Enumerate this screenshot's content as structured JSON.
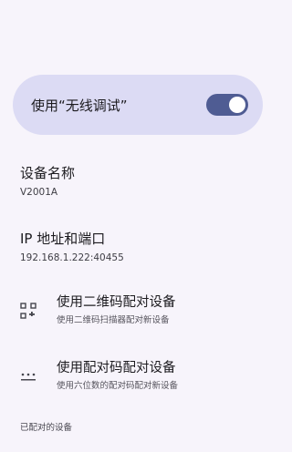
{
  "wireless_debugging": {
    "label": "使用“无线调试”",
    "enabled": true
  },
  "device_name": {
    "title": "设备名称",
    "value": "V2001A"
  },
  "ip_port": {
    "title": "IP 地址和端口",
    "value": "192.168.1.222:40455"
  },
  "pair_qr": {
    "title": "使用二维码配对设备",
    "subtitle": "使用二维码扫描器配对新设备",
    "icon": "qr-code-icon"
  },
  "pair_code": {
    "title": "使用配对码配对设备",
    "subtitle": "使用六位数的配对码配对新设备",
    "icon": "dialpad-icon"
  },
  "paired_devices": {
    "label": "已配对的设备"
  },
  "colors": {
    "background": "#f7f4fb",
    "card": "#dcdbf4",
    "switch_on": "#4f5c93"
  }
}
